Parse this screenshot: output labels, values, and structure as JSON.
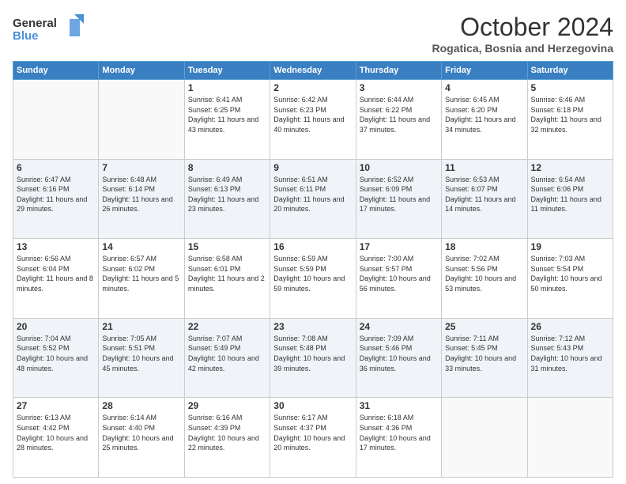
{
  "header": {
    "logo_line1": "General",
    "logo_line2": "Blue",
    "month": "October 2024",
    "location": "Rogatica, Bosnia and Herzegovina"
  },
  "days_of_week": [
    "Sunday",
    "Monday",
    "Tuesday",
    "Wednesday",
    "Thursday",
    "Friday",
    "Saturday"
  ],
  "weeks": [
    [
      {
        "day": "",
        "sunrise": "",
        "sunset": "",
        "daylight": ""
      },
      {
        "day": "",
        "sunrise": "",
        "sunset": "",
        "daylight": ""
      },
      {
        "day": "1",
        "sunrise": "Sunrise: 6:41 AM",
        "sunset": "Sunset: 6:25 PM",
        "daylight": "Daylight: 11 hours and 43 minutes."
      },
      {
        "day": "2",
        "sunrise": "Sunrise: 6:42 AM",
        "sunset": "Sunset: 6:23 PM",
        "daylight": "Daylight: 11 hours and 40 minutes."
      },
      {
        "day": "3",
        "sunrise": "Sunrise: 6:44 AM",
        "sunset": "Sunset: 6:22 PM",
        "daylight": "Daylight: 11 hours and 37 minutes."
      },
      {
        "day": "4",
        "sunrise": "Sunrise: 6:45 AM",
        "sunset": "Sunset: 6:20 PM",
        "daylight": "Daylight: 11 hours and 34 minutes."
      },
      {
        "day": "5",
        "sunrise": "Sunrise: 6:46 AM",
        "sunset": "Sunset: 6:18 PM",
        "daylight": "Daylight: 11 hours and 32 minutes."
      }
    ],
    [
      {
        "day": "6",
        "sunrise": "Sunrise: 6:47 AM",
        "sunset": "Sunset: 6:16 PM",
        "daylight": "Daylight: 11 hours and 29 minutes."
      },
      {
        "day": "7",
        "sunrise": "Sunrise: 6:48 AM",
        "sunset": "Sunset: 6:14 PM",
        "daylight": "Daylight: 11 hours and 26 minutes."
      },
      {
        "day": "8",
        "sunrise": "Sunrise: 6:49 AM",
        "sunset": "Sunset: 6:13 PM",
        "daylight": "Daylight: 11 hours and 23 minutes."
      },
      {
        "day": "9",
        "sunrise": "Sunrise: 6:51 AM",
        "sunset": "Sunset: 6:11 PM",
        "daylight": "Daylight: 11 hours and 20 minutes."
      },
      {
        "day": "10",
        "sunrise": "Sunrise: 6:52 AM",
        "sunset": "Sunset: 6:09 PM",
        "daylight": "Daylight: 11 hours and 17 minutes."
      },
      {
        "day": "11",
        "sunrise": "Sunrise: 6:53 AM",
        "sunset": "Sunset: 6:07 PM",
        "daylight": "Daylight: 11 hours and 14 minutes."
      },
      {
        "day": "12",
        "sunrise": "Sunrise: 6:54 AM",
        "sunset": "Sunset: 6:06 PM",
        "daylight": "Daylight: 11 hours and 11 minutes."
      }
    ],
    [
      {
        "day": "13",
        "sunrise": "Sunrise: 6:56 AM",
        "sunset": "Sunset: 6:04 PM",
        "daylight": "Daylight: 11 hours and 8 minutes."
      },
      {
        "day": "14",
        "sunrise": "Sunrise: 6:57 AM",
        "sunset": "Sunset: 6:02 PM",
        "daylight": "Daylight: 11 hours and 5 minutes."
      },
      {
        "day": "15",
        "sunrise": "Sunrise: 6:58 AM",
        "sunset": "Sunset: 6:01 PM",
        "daylight": "Daylight: 11 hours and 2 minutes."
      },
      {
        "day": "16",
        "sunrise": "Sunrise: 6:59 AM",
        "sunset": "Sunset: 5:59 PM",
        "daylight": "Daylight: 10 hours and 59 minutes."
      },
      {
        "day": "17",
        "sunrise": "Sunrise: 7:00 AM",
        "sunset": "Sunset: 5:57 PM",
        "daylight": "Daylight: 10 hours and 56 minutes."
      },
      {
        "day": "18",
        "sunrise": "Sunrise: 7:02 AM",
        "sunset": "Sunset: 5:56 PM",
        "daylight": "Daylight: 10 hours and 53 minutes."
      },
      {
        "day": "19",
        "sunrise": "Sunrise: 7:03 AM",
        "sunset": "Sunset: 5:54 PM",
        "daylight": "Daylight: 10 hours and 50 minutes."
      }
    ],
    [
      {
        "day": "20",
        "sunrise": "Sunrise: 7:04 AM",
        "sunset": "Sunset: 5:52 PM",
        "daylight": "Daylight: 10 hours and 48 minutes."
      },
      {
        "day": "21",
        "sunrise": "Sunrise: 7:05 AM",
        "sunset": "Sunset: 5:51 PM",
        "daylight": "Daylight: 10 hours and 45 minutes."
      },
      {
        "day": "22",
        "sunrise": "Sunrise: 7:07 AM",
        "sunset": "Sunset: 5:49 PM",
        "daylight": "Daylight: 10 hours and 42 minutes."
      },
      {
        "day": "23",
        "sunrise": "Sunrise: 7:08 AM",
        "sunset": "Sunset: 5:48 PM",
        "daylight": "Daylight: 10 hours and 39 minutes."
      },
      {
        "day": "24",
        "sunrise": "Sunrise: 7:09 AM",
        "sunset": "Sunset: 5:46 PM",
        "daylight": "Daylight: 10 hours and 36 minutes."
      },
      {
        "day": "25",
        "sunrise": "Sunrise: 7:11 AM",
        "sunset": "Sunset: 5:45 PM",
        "daylight": "Daylight: 10 hours and 33 minutes."
      },
      {
        "day": "26",
        "sunrise": "Sunrise: 7:12 AM",
        "sunset": "Sunset: 5:43 PM",
        "daylight": "Daylight: 10 hours and 31 minutes."
      }
    ],
    [
      {
        "day": "27",
        "sunrise": "Sunrise: 6:13 AM",
        "sunset": "Sunset: 4:42 PM",
        "daylight": "Daylight: 10 hours and 28 minutes."
      },
      {
        "day": "28",
        "sunrise": "Sunrise: 6:14 AM",
        "sunset": "Sunset: 4:40 PM",
        "daylight": "Daylight: 10 hours and 25 minutes."
      },
      {
        "day": "29",
        "sunrise": "Sunrise: 6:16 AM",
        "sunset": "Sunset: 4:39 PM",
        "daylight": "Daylight: 10 hours and 22 minutes."
      },
      {
        "day": "30",
        "sunrise": "Sunrise: 6:17 AM",
        "sunset": "Sunset: 4:37 PM",
        "daylight": "Daylight: 10 hours and 20 minutes."
      },
      {
        "day": "31",
        "sunrise": "Sunrise: 6:18 AM",
        "sunset": "Sunset: 4:36 PM",
        "daylight": "Daylight: 10 hours and 17 minutes."
      },
      {
        "day": "",
        "sunrise": "",
        "sunset": "",
        "daylight": ""
      },
      {
        "day": "",
        "sunrise": "",
        "sunset": "",
        "daylight": ""
      }
    ]
  ]
}
